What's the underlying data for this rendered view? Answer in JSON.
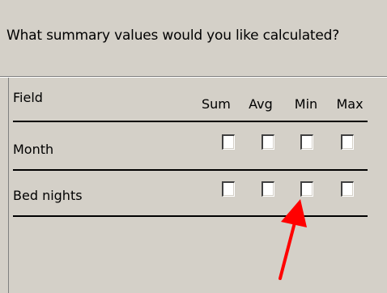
{
  "prompt": "What summary values would you like calculated?",
  "table": {
    "field_header": "Field",
    "columns": [
      "Sum",
      "Avg",
      "Min",
      "Max"
    ],
    "rows": [
      {
        "label": "Month",
        "checks": [
          false,
          false,
          false,
          false
        ]
      },
      {
        "label": "Bed nights",
        "checks": [
          false,
          false,
          false,
          false
        ]
      }
    ]
  },
  "annotation": {
    "arrow_color": "#ff0000",
    "arrow_target": "Bed nights / Min checkbox"
  },
  "colors": {
    "dialog_face": "#d4d0c8",
    "rule": "#000000"
  },
  "icons": {
    "annotation": "red-arrow-icon"
  }
}
